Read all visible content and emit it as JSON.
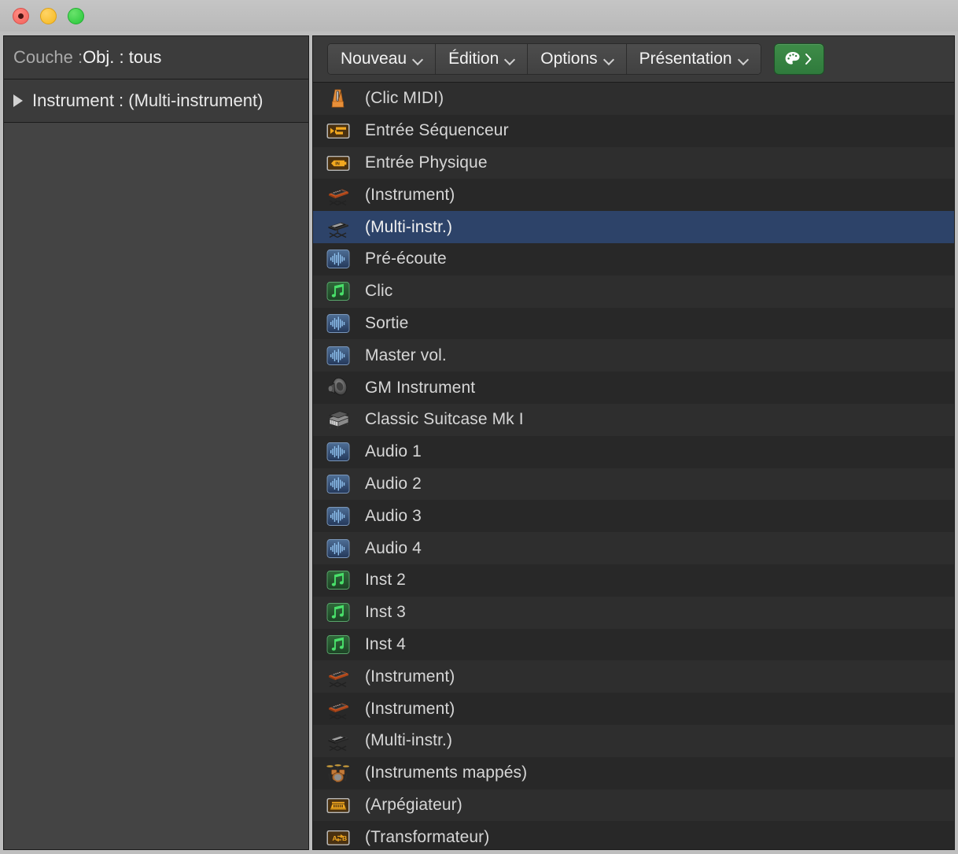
{
  "window": {
    "traffic_lights": [
      "close",
      "minimize",
      "zoom"
    ]
  },
  "left_panel": {
    "header": {
      "prefix": "Couche : ",
      "value": "Obj. : tous"
    },
    "tree_item": {
      "label": "Instrument : (Multi-instrument)",
      "disclosure": "collapsed-triangle"
    }
  },
  "toolbar": {
    "menus": [
      {
        "label": "Nouveau",
        "icon": "chevron-down-icon"
      },
      {
        "label": "Édition",
        "icon": "chevron-down-icon"
      },
      {
        "label": "Options",
        "icon": "chevron-down-icon"
      },
      {
        "label": "Présentation",
        "icon": "chevron-down-icon"
      }
    ],
    "palette_button": {
      "icon": "palette-icon",
      "chevron": "›"
    }
  },
  "colors": {
    "selection": "#2d4369",
    "row_odd": "#2e2e2e",
    "row_even": "#282828",
    "accent_green": "#2f7a3c",
    "text": "#d6d6d6"
  },
  "list": {
    "items": [
      {
        "label": "(Clic MIDI)",
        "icon": "metronome-icon",
        "selected": false
      },
      {
        "label": "Entrée Séquenceur",
        "icon": "sequencer-in-icon",
        "selected": false
      },
      {
        "label": "Entrée Physique",
        "icon": "physical-in-icon",
        "selected": false
      },
      {
        "label": "(Instrument)",
        "icon": "keyboard-icon",
        "selected": false
      },
      {
        "label": "(Multi-instr.)",
        "icon": "multi-keyboard-icon",
        "selected": true
      },
      {
        "label": "Pré-écoute",
        "icon": "waveform-icon",
        "selected": false
      },
      {
        "label": "Clic",
        "icon": "music-note-icon",
        "selected": false
      },
      {
        "label": "Sortie",
        "icon": "waveform-icon",
        "selected": false
      },
      {
        "label": "Master vol.",
        "icon": "waveform-icon",
        "selected": false
      },
      {
        "label": "GM Instrument",
        "icon": "speaker-icon",
        "selected": false
      },
      {
        "label": "Classic Suitcase Mk I",
        "icon": "piano-icon",
        "selected": false
      },
      {
        "label": "Audio 1",
        "icon": "waveform-icon",
        "selected": false
      },
      {
        "label": "Audio 2",
        "icon": "waveform-icon",
        "selected": false
      },
      {
        "label": "Audio 3",
        "icon": "waveform-icon",
        "selected": false
      },
      {
        "label": "Audio 4",
        "icon": "waveform-icon",
        "selected": false
      },
      {
        "label": "Inst 2",
        "icon": "music-note-icon",
        "selected": false
      },
      {
        "label": "Inst 3",
        "icon": "music-note-icon",
        "selected": false
      },
      {
        "label": "Inst 4",
        "icon": "music-note-icon",
        "selected": false
      },
      {
        "label": "(Instrument)",
        "icon": "keyboard-icon",
        "selected": false
      },
      {
        "label": "(Instrument)",
        "icon": "keyboard-icon",
        "selected": false
      },
      {
        "label": "(Multi-instr.)",
        "icon": "multi-keyboard-icon",
        "selected": false
      },
      {
        "label": "(Instruments mappés)",
        "icon": "drumkit-icon",
        "selected": false
      },
      {
        "label": "(Arpégiateur)",
        "icon": "arpeggiator-icon",
        "selected": false
      },
      {
        "label": "(Transformateur)",
        "icon": "transformer-icon",
        "selected": false
      }
    ]
  }
}
